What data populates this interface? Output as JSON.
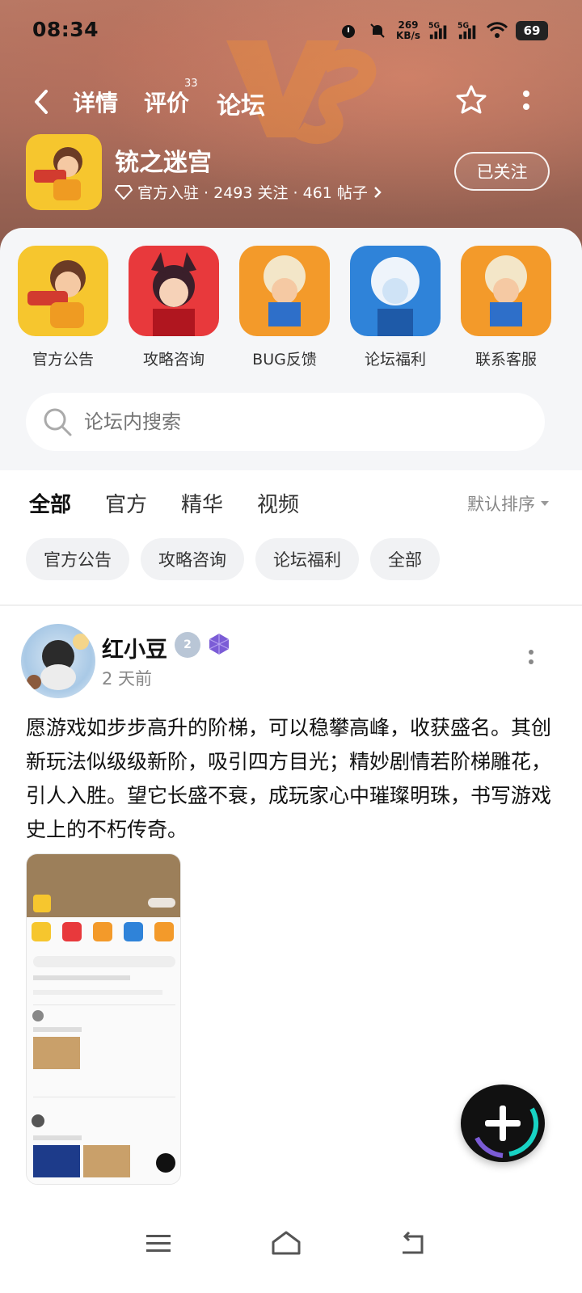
{
  "status": {
    "time": "08:34",
    "net_speed_value": "269",
    "net_speed_unit": "KB/s",
    "sig1": "5G",
    "sig2": "5G",
    "battery": "69"
  },
  "nav": {
    "tabs": [
      {
        "label": "详情"
      },
      {
        "label": "评价",
        "badge": "33"
      },
      {
        "label": "论坛"
      }
    ]
  },
  "game": {
    "title": "铳之迷宫",
    "meta": "官方入驻 · 2493 关注 · 461 帖子",
    "follow_label": "已关注"
  },
  "shortcuts": [
    {
      "label": "官方公告"
    },
    {
      "label": "攻略咨询"
    },
    {
      "label": "BUG反馈"
    },
    {
      "label": "论坛福利"
    },
    {
      "label": "联系客服"
    }
  ],
  "search": {
    "placeholder": "论坛内搜索"
  },
  "tabs": [
    {
      "label": "全部"
    },
    {
      "label": "官方"
    },
    {
      "label": "精华"
    },
    {
      "label": "视频"
    }
  ],
  "sort_label": "默认排序",
  "chips": [
    {
      "label": "官方公告"
    },
    {
      "label": "攻略咨询"
    },
    {
      "label": "论坛福利"
    },
    {
      "label": "全部"
    }
  ],
  "post": {
    "author": "红小豆",
    "level_badge": "2",
    "time": "2 天前",
    "text": "愿游戏如步步高升的阶梯，可以稳攀高峰，收获盛名。其创新玩法似级级新阶，吸引四方目光；精妙剧情若阶梯雕花，引人入胜。望它长盛不衰，成玩家心中璀璨明珠，书写游戏史上的不朽传奇。"
  },
  "colors": {
    "accent": "#18d3c4",
    "banner": "#a96d5c"
  }
}
